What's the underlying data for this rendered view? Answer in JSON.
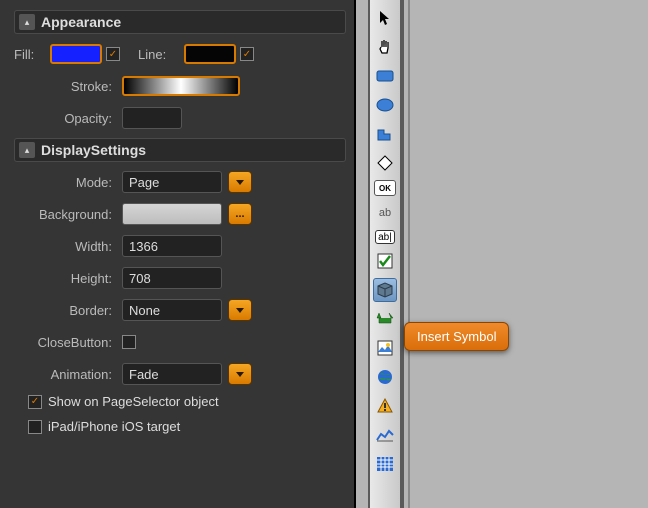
{
  "appearance": {
    "title": "Appearance",
    "fill_label": "Fill:",
    "fill_color": "#1522ff",
    "fill_checked": true,
    "line_label": "Line:",
    "line_color": "#050505",
    "line_checked": true,
    "stroke_label": "Stroke:",
    "opacity_label": "Opacity:",
    "opacity_value": ""
  },
  "display": {
    "title": "DisplaySettings",
    "mode_label": "Mode:",
    "mode_value": "Page",
    "background_label": "Background:",
    "width_label": "Width:",
    "width_value": "1366",
    "height_label": "Height:",
    "height_value": "708",
    "border_label": "Border:",
    "border_value": "None",
    "close_label": "CloseButton:",
    "close_checked": false,
    "animation_label": "Animation:",
    "animation_value": "Fade",
    "show_selector_label": "Show on PageSelector object",
    "show_selector_checked": true,
    "ios_label": "iPad/iPhone iOS target",
    "ios_checked": false
  },
  "tooltip": "Insert Symbol",
  "tools": {
    "ok_label": "OK",
    "text_label": "ab",
    "textbox_label": "ab|"
  }
}
